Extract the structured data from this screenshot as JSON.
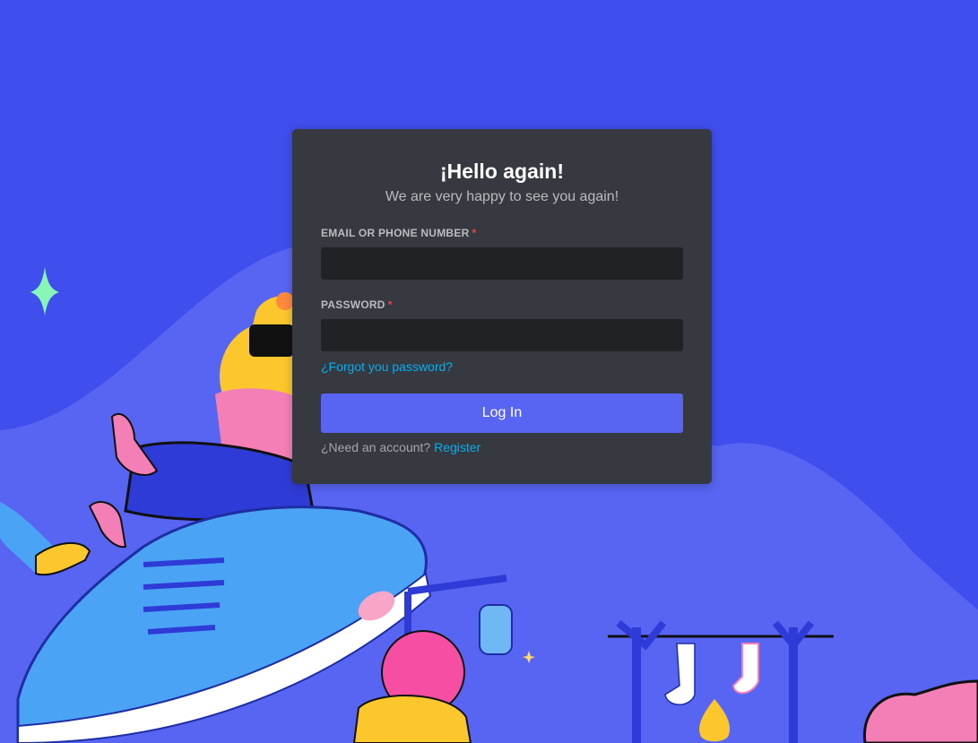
{
  "login": {
    "title": "¡Hello again!",
    "subtitle": "We are very happy to see you again!",
    "email_label": "EMAIL OR PHONE NUMBER",
    "email_value": "",
    "password_label": "PASSWORD",
    "password_value": "",
    "required_mark": "*",
    "forgot_link": "¿Forgot you password?",
    "login_button": "Log In",
    "need_account": "¿Need an account?",
    "register_link": "Register"
  },
  "colors": {
    "background": "#404eed",
    "card": "#36393f",
    "input": "#202225",
    "button": "#5865f2",
    "link": "#00aff4",
    "required": "#ed4245"
  },
  "icons": [
    "sparkle-icon",
    "star-icon"
  ]
}
